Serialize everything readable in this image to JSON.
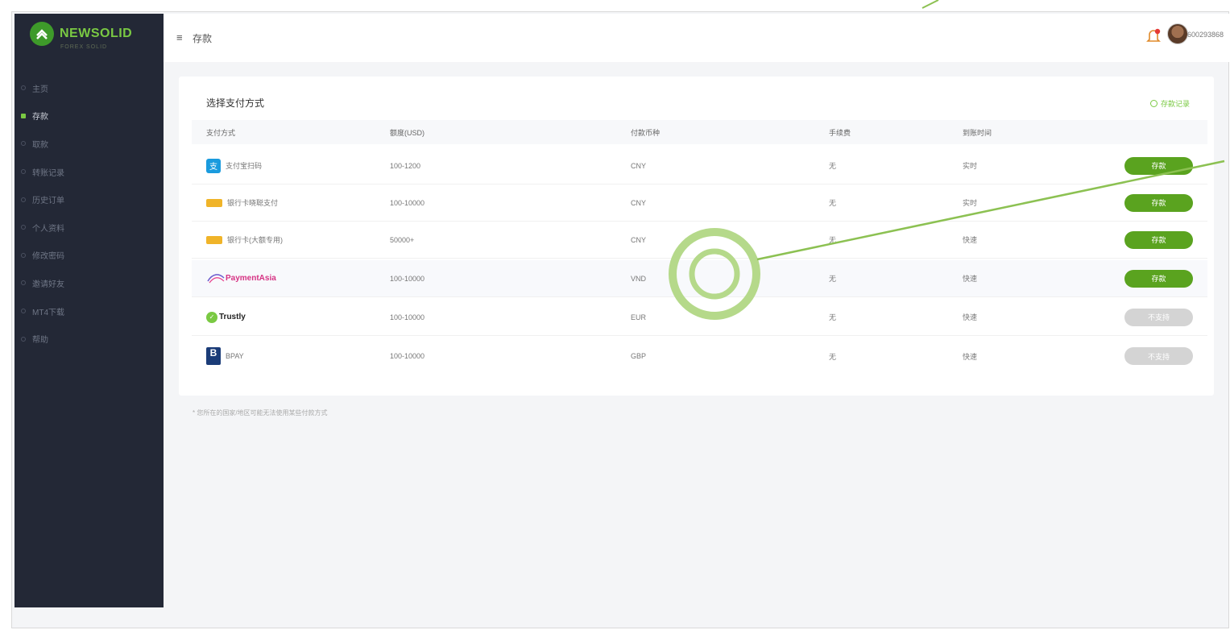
{
  "brand": {
    "name": "NEWSOLID",
    "tagline": "FOREX SOLID"
  },
  "sidebar": {
    "items": [
      {
        "label": "主页",
        "active": false
      },
      {
        "label": "存款",
        "active": true
      },
      {
        "label": "取款",
        "active": false
      },
      {
        "label": "转账记录",
        "active": false
      },
      {
        "label": "历史订单",
        "active": false
      },
      {
        "label": "个人资料",
        "active": false
      },
      {
        "label": "修改密码",
        "active": false
      },
      {
        "label": "邀请好友",
        "active": false
      },
      {
        "label": "MT4下载",
        "active": false
      },
      {
        "label": "帮助",
        "active": false
      }
    ]
  },
  "header": {
    "menu_icon": "≡",
    "title": "存款",
    "username": "600293868"
  },
  "card": {
    "title": "选择支付方式",
    "history_link": "存款记录",
    "columns": [
      "支付方式",
      "额度(USD)",
      "付款币种",
      "手续费",
      "到账时间"
    ],
    "rows": [
      {
        "method": "支付宝扫码",
        "logo": "alipay",
        "limit": "100-1200",
        "currency": "CNY",
        "fee": "无",
        "time": "实时",
        "button": "存款",
        "enabled": true
      },
      {
        "method": "银行卡晓聪支付",
        "logo": "bankcard",
        "limit": "100-10000",
        "currency": "CNY",
        "fee": "无",
        "time": "实时",
        "button": "存款",
        "enabled": true
      },
      {
        "method": "银行卡(大额专用)",
        "logo": "bankcard",
        "limit": "50000+",
        "currency": "CNY",
        "fee": "无",
        "time": "快速",
        "button": "存款",
        "enabled": true
      },
      {
        "method": "PaymentAsia",
        "logo": "paymentasia",
        "limit": "100-10000",
        "currency": "VND",
        "fee": "无",
        "time": "快速",
        "button": "存款",
        "enabled": true
      },
      {
        "method": "Trustly",
        "logo": "trustly",
        "limit": "100-10000",
        "currency": "EUR",
        "fee": "无",
        "time": "快速",
        "button": "不支持",
        "enabled": false
      },
      {
        "method": "BPAY",
        "logo": "bpay",
        "limit": "100-10000",
        "currency": "GBP",
        "fee": "无",
        "time": "快速",
        "button": "不支持",
        "enabled": false
      }
    ]
  },
  "footnote": "* 您所在的国家/地区可能无法使用某些付款方式",
  "colors": {
    "accent": "#5aa31f",
    "sidebar": "#232836",
    "disabled": "#d4d4d4",
    "annotation": "#a8d26e"
  }
}
